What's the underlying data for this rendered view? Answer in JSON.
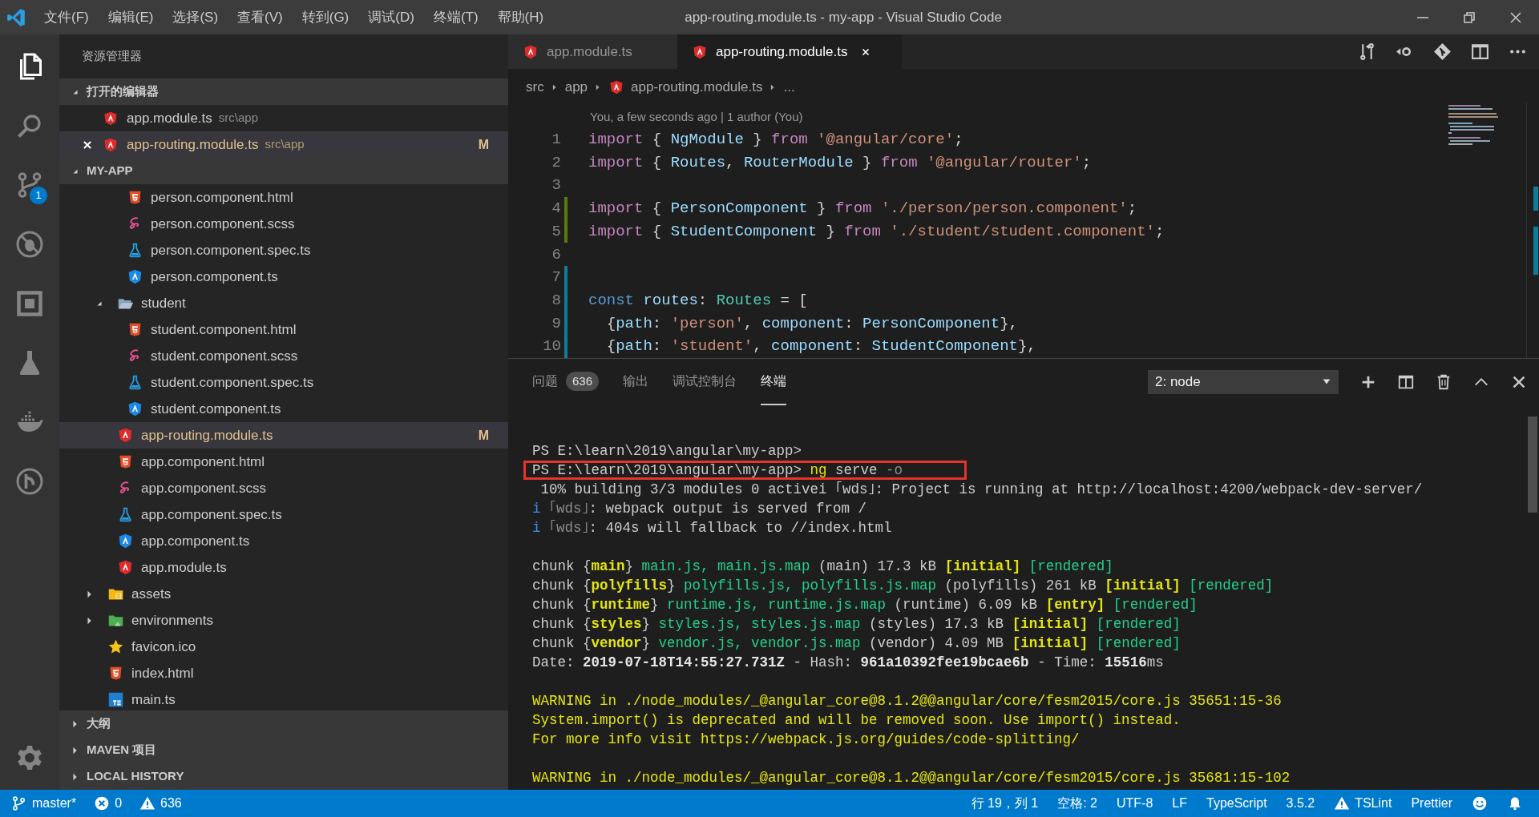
{
  "window": {
    "title": "app-routing.module.ts - my-app - Visual Studio Code"
  },
  "menu": [
    "文件(F)",
    "编辑(E)",
    "选择(S)",
    "查看(V)",
    "转到(G)",
    "调试(D)",
    "终端(T)",
    "帮助(H)"
  ],
  "window_controls": [
    {
      "kind": "minimize"
    },
    {
      "kind": "restore"
    },
    {
      "kind": "close"
    }
  ],
  "activity_bar": [
    {
      "kind": "files",
      "selected": true
    },
    {
      "kind": "search",
      "selected": false
    },
    {
      "kind": "scm",
      "selected": false,
      "badge": "1"
    },
    {
      "kind": "debug",
      "selected": false
    },
    {
      "kind": "extensions",
      "selected": false
    },
    {
      "kind": "test",
      "selected": false
    },
    {
      "kind": "docker",
      "selected": false
    },
    {
      "kind": "history",
      "selected": false
    },
    {
      "kind": "settings",
      "selected": false
    }
  ],
  "sidebar": {
    "title": "资源管理器",
    "open_editors": {
      "title": "打开的编辑器",
      "expanded": true,
      "items": [
        {
          "name": "app.module.ts",
          "path": "src\\app",
          "kind": "angular-red",
          "selected": false,
          "modified": false
        },
        {
          "name": "app-routing.module.ts",
          "path": "src\\app",
          "kind": "angular-red",
          "selected": true,
          "modified": true,
          "status": "M"
        }
      ]
    },
    "project": {
      "title": "MY-APP",
      "expanded": true,
      "tree": [
        {
          "children": [
            {
              "children": [
                {
                  "name": "person.component.html",
                  "kind": "html",
                  "selected": false,
                  "modified": false
                },
                {
                  "name": "person.component.scss",
                  "kind": "sass",
                  "selected": false,
                  "modified": false
                },
                {
                  "name": "person.component.spec.ts",
                  "kind": "spec",
                  "selected": false,
                  "modified": false
                },
                {
                  "name": "person.component.ts",
                  "kind": "angular-blue",
                  "selected": false,
                  "modified": false
                }
              ]
            },
            {
              "name": "student",
              "kind": "folder-open",
              "expanded": true,
              "selected": false,
              "modified": false,
              "children": [
                {
                  "name": "student.component.html",
                  "kind": "html",
                  "selected": false,
                  "modified": false
                },
                {
                  "name": "student.component.scss",
                  "kind": "sass",
                  "selected": false,
                  "modified": false
                },
                {
                  "name": "student.component.spec.ts",
                  "kind": "spec",
                  "selected": false,
                  "modified": false
                },
                {
                  "name": "student.component.ts",
                  "kind": "angular-blue",
                  "selected": false,
                  "modified": false
                }
              ]
            },
            {
              "name": "app-routing.module.ts",
              "kind": "angular-red",
              "selected": true,
              "modified": true,
              "status": "M"
            },
            {
              "name": "app.component.html",
              "kind": "html",
              "selected": false,
              "modified": false
            },
            {
              "name": "app.component.scss",
              "kind": "sass",
              "selected": false,
              "modified": false
            },
            {
              "name": "app.component.spec.ts",
              "kind": "spec",
              "selected": false,
              "modified": false
            },
            {
              "name": "app.component.ts",
              "kind": "angular-blue",
              "selected": false,
              "modified": false
            },
            {
              "name": "app.module.ts",
              "kind": "angular-red",
              "selected": false,
              "modified": false
            }
          ]
        },
        {
          "name": "assets",
          "kind": "folder-assets",
          "expanded": false,
          "selected": false,
          "modified": false
        },
        {
          "name": "environments",
          "kind": "folder-env",
          "expanded": false,
          "selected": false,
          "modified": false
        },
        {
          "name": "favicon.ico",
          "kind": "star",
          "selected": false,
          "modified": false
        },
        {
          "name": "index.html",
          "kind": "html",
          "selected": false,
          "modified": false
        },
        {
          "name": "main.ts",
          "kind": "ts",
          "selected": false,
          "modified": false
        }
      ]
    },
    "sections": [
      {
        "title": "大纲",
        "expanded": false
      },
      {
        "title": "MAVEN 项目",
        "expanded": false
      },
      {
        "title": "LOCAL HISTORY",
        "expanded": false
      }
    ]
  },
  "editor": {
    "tabs": [
      {
        "label": "app.module.ts",
        "kind": "angular-red",
        "selected": false
      },
      {
        "label": "app-routing.module.ts",
        "kind": "angular-red",
        "selected": true
      }
    ],
    "actions": [
      {
        "kind": "compare"
      },
      {
        "kind": "back"
      },
      {
        "kind": "git"
      },
      {
        "kind": "split"
      },
      {
        "kind": "more"
      }
    ],
    "breadcrumb": [
      {
        "label": "src"
      },
      {
        "label": "app"
      },
      {
        "label": "app-routing.module.ts",
        "kind": "angular-red"
      },
      {
        "label": "..."
      }
    ],
    "codelens": "You, a few seconds ago | 1 author (You)",
    "lines": [
      {
        "number": "1",
        "kind": "unchanged",
        "tokens": [
          {
            "t": "import",
            "kind": "keyword"
          },
          {
            "t": " { ",
            "kind": "plain"
          },
          {
            "t": "NgModule",
            "kind": "var"
          },
          {
            "t": " } ",
            "kind": "plain"
          },
          {
            "t": "from ",
            "kind": "keyword"
          },
          {
            "t": "'@angular/core'",
            "kind": "string"
          },
          {
            "t": ";",
            "kind": "plain"
          }
        ]
      },
      {
        "number": "2",
        "kind": "unchanged",
        "tokens": [
          {
            "t": "import",
            "kind": "keyword"
          },
          {
            "t": " { ",
            "kind": "plain"
          },
          {
            "t": "Routes",
            "kind": "var"
          },
          {
            "t": ", ",
            "kind": "plain"
          },
          {
            "t": "RouterModule",
            "kind": "var"
          },
          {
            "t": " } ",
            "kind": "plain"
          },
          {
            "t": "from ",
            "kind": "keyword"
          },
          {
            "t": "'@angular/router'",
            "kind": "string"
          },
          {
            "t": ";",
            "kind": "plain"
          }
        ]
      },
      {
        "number": "3",
        "kind": "unchanged"
      },
      {
        "number": "4",
        "kind": "added",
        "tokens": [
          {
            "t": "import",
            "kind": "keyword"
          },
          {
            "t": " { ",
            "kind": "plain"
          },
          {
            "t": "PersonComponent",
            "kind": "var"
          },
          {
            "t": " } ",
            "kind": "plain"
          },
          {
            "t": "from ",
            "kind": "keyword"
          },
          {
            "t": "'./person/person.component'",
            "kind": "string"
          },
          {
            "t": ";",
            "kind": "plain"
          }
        ]
      },
      {
        "number": "5",
        "kind": "added",
        "tokens": [
          {
            "t": "import",
            "kind": "keyword"
          },
          {
            "t": " { ",
            "kind": "plain"
          },
          {
            "t": "StudentComponent",
            "kind": "var"
          },
          {
            "t": " } ",
            "kind": "plain"
          },
          {
            "t": "from ",
            "kind": "keyword"
          },
          {
            "t": "'./student/student.component'",
            "kind": "string"
          },
          {
            "t": ";",
            "kind": "plain"
          }
        ]
      },
      {
        "number": "6",
        "kind": "unchanged"
      },
      {
        "number": "7",
        "kind": "modified"
      },
      {
        "number": "8",
        "kind": "modified",
        "tokens": [
          {
            "t": "const ",
            "kind": "storage"
          },
          {
            "t": "routes",
            "kind": "var"
          },
          {
            "t": ": ",
            "kind": "plain"
          },
          {
            "t": "Routes",
            "kind": "type"
          },
          {
            "t": " = [",
            "kind": "plain"
          }
        ]
      },
      {
        "number": "9",
        "kind": "modified",
        "tokens": [
          {
            "t": "  {",
            "kind": "plain"
          },
          {
            "t": "path",
            "kind": "var"
          },
          {
            "t": ": ",
            "kind": "plain"
          },
          {
            "t": "'person'",
            "kind": "string"
          },
          {
            "t": ", ",
            "kind": "plain"
          },
          {
            "t": "component",
            "kind": "var"
          },
          {
            "t": ": ",
            "kind": "plain"
          },
          {
            "t": "PersonComponent",
            "kind": "var"
          },
          {
            "t": "},",
            "kind": "plain"
          }
        ]
      },
      {
        "number": "10",
        "kind": "modified",
        "tokens": [
          {
            "t": "  {",
            "kind": "plain"
          },
          {
            "t": "path",
            "kind": "var"
          },
          {
            "t": ": ",
            "kind": "plain"
          },
          {
            "t": "'student'",
            "kind": "string"
          },
          {
            "t": ", ",
            "kind": "plain"
          },
          {
            "t": "component",
            "kind": "var"
          },
          {
            "t": ": ",
            "kind": "plain"
          },
          {
            "t": "StudentComponent",
            "kind": "var"
          },
          {
            "t": "},",
            "kind": "plain"
          }
        ]
      }
    ]
  },
  "panel": {
    "tabs": [
      {
        "label": "问题",
        "badge": "636",
        "selected": false
      },
      {
        "label": "输出",
        "selected": false
      },
      {
        "label": "调试控制台",
        "selected": false
      },
      {
        "label": "终端",
        "selected": true
      }
    ],
    "terminal_select": "2: node",
    "actions": [
      {
        "kind": "add"
      },
      {
        "kind": "split"
      },
      {
        "kind": "trash"
      },
      {
        "kind": "maximize"
      },
      {
        "kind": "close"
      }
    ],
    "terminal": [
      {
        "kind": "output",
        "segments": [
          {
            "t": "PS E:\\learn\\2019\\angular\\my-app>",
            "kind": "plain"
          }
        ]
      },
      {
        "kind": "output",
        "segments": [
          {
            "t": "PS E:\\learn\\2019\\angular\\my-app> ",
            "kind": "plain"
          },
          {
            "t": "ng",
            "kind": "warning"
          },
          {
            "t": " serve",
            "kind": "plain"
          },
          {
            "t": " -o",
            "kind": "dim"
          }
        ]
      },
      {
        "kind": "output",
        "segments": [
          {
            "t": " 10% building 3/3 modules 0 activei ｢wds｣: Project is running at http://localhost:4200/webpack-dev-server/",
            "kind": "plain"
          }
        ]
      },
      {
        "kind": "output",
        "segments": [
          {
            "t": "i",
            "kind": "info"
          },
          {
            "t": " ｢wds｣",
            "kind": "dim"
          },
          {
            "t": ": webpack output is served from /",
            "kind": "plain"
          }
        ]
      },
      {
        "kind": "output",
        "segments": [
          {
            "t": "i",
            "kind": "info"
          },
          {
            "t": " ｢wds｣",
            "kind": "dim"
          },
          {
            "t": ": 404s will fallback to //index.html",
            "kind": "plain"
          }
        ]
      },
      {
        "kind": "blank"
      },
      {
        "kind": "output",
        "segments": [
          {
            "t": "chunk {",
            "kind": "plain"
          },
          {
            "t": "main",
            "kind": "accent"
          },
          {
            "t": "} ",
            "kind": "plain"
          },
          {
            "t": "main.js, main.js.map",
            "kind": "file"
          },
          {
            "t": " (main) 17.3 kB ",
            "kind": "plain"
          },
          {
            "t": "[initial] ",
            "kind": "accent"
          },
          {
            "t": "[rendered]",
            "kind": "file"
          }
        ]
      },
      {
        "kind": "output",
        "segments": [
          {
            "t": "chunk {",
            "kind": "plain"
          },
          {
            "t": "polyfills",
            "kind": "accent"
          },
          {
            "t": "} ",
            "kind": "plain"
          },
          {
            "t": "polyfills.js, polyfills.js.map",
            "kind": "file"
          },
          {
            "t": " (polyfills) 261 kB ",
            "kind": "plain"
          },
          {
            "t": "[initial] ",
            "kind": "accent"
          },
          {
            "t": "[rendered]",
            "kind": "file"
          }
        ]
      },
      {
        "kind": "output",
        "segments": [
          {
            "t": "chunk {",
            "kind": "plain"
          },
          {
            "t": "runtime",
            "kind": "accent"
          },
          {
            "t": "} ",
            "kind": "plain"
          },
          {
            "t": "runtime.js, runtime.js.map",
            "kind": "file"
          },
          {
            "t": " (runtime) 6.09 kB ",
            "kind": "plain"
          },
          {
            "t": "[entry] ",
            "kind": "accent"
          },
          {
            "t": "[rendered]",
            "kind": "file"
          }
        ]
      },
      {
        "kind": "output",
        "segments": [
          {
            "t": "chunk {",
            "kind": "plain"
          },
          {
            "t": "styles",
            "kind": "accent"
          },
          {
            "t": "} ",
            "kind": "plain"
          },
          {
            "t": "styles.js, styles.js.map",
            "kind": "file"
          },
          {
            "t": " (styles) 17.3 kB ",
            "kind": "plain"
          },
          {
            "t": "[initial] ",
            "kind": "accent"
          },
          {
            "t": "[rendered]",
            "kind": "file"
          }
        ]
      },
      {
        "kind": "output",
        "segments": [
          {
            "t": "chunk {",
            "kind": "plain"
          },
          {
            "t": "vendor",
            "kind": "accent"
          },
          {
            "t": "} ",
            "kind": "plain"
          },
          {
            "t": "vendor.js, vendor.js.map",
            "kind": "file"
          },
          {
            "t": " (vendor) 4.09 MB ",
            "kind": "plain"
          },
          {
            "t": "[initial] ",
            "kind": "accent"
          },
          {
            "t": "[rendered]",
            "kind": "file"
          }
        ]
      },
      {
        "kind": "output",
        "segments": [
          {
            "t": "Date: ",
            "kind": "plain"
          },
          {
            "t": "2019-07-18T14:55:27.731Z",
            "kind": "bold"
          },
          {
            "t": " - Hash: ",
            "kind": "plain"
          },
          {
            "t": "961a10392fee19bcae6b",
            "kind": "bold"
          },
          {
            "t": " - Time: ",
            "kind": "plain"
          },
          {
            "t": "15516",
            "kind": "bold"
          },
          {
            "t": "ms",
            "kind": "plain"
          }
        ]
      },
      {
        "kind": "blank"
      },
      {
        "kind": "output",
        "segments": [
          {
            "t": "WARNING in ./node_modules/_@angular_core@8.1.2@@angular/core/fesm2015/core.js 35651:15-36",
            "kind": "warning"
          }
        ]
      },
      {
        "kind": "output",
        "segments": [
          {
            "t": "System.import() is deprecated and will be removed soon. Use import() instead.",
            "kind": "warning"
          }
        ]
      },
      {
        "kind": "output",
        "segments": [
          {
            "t": "For more info visit https://webpack.js.org/guides/code-splitting/",
            "kind": "warning"
          }
        ]
      },
      {
        "kind": "blank"
      },
      {
        "kind": "output",
        "segments": [
          {
            "t": "WARNING in ./node_modules/_@angular_core@8.1.2@@angular/core/fesm2015/core.js 35681:15-102",
            "kind": "warning"
          }
        ]
      }
    ]
  },
  "status_bar": {
    "left": [
      {
        "kind": "branch",
        "text": "master*"
      },
      {
        "kind": "errors",
        "text": "0"
      },
      {
        "kind": "warnings",
        "text": "636"
      }
    ],
    "right": [
      {
        "kind": "text",
        "text": "行 19，列 1"
      },
      {
        "kind": "text",
        "text": "空格: 2"
      },
      {
        "kind": "text",
        "text": "UTF-8"
      },
      {
        "kind": "text",
        "text": "LF"
      },
      {
        "kind": "text",
        "text": "TypeScript"
      },
      {
        "kind": "text",
        "text": "3.5.2"
      },
      {
        "kind": "tslint",
        "text": "TSLint"
      },
      {
        "kind": "text",
        "text": "Prettier"
      },
      {
        "kind": "smiley"
      },
      {
        "kind": "bell"
      }
    ]
  }
}
